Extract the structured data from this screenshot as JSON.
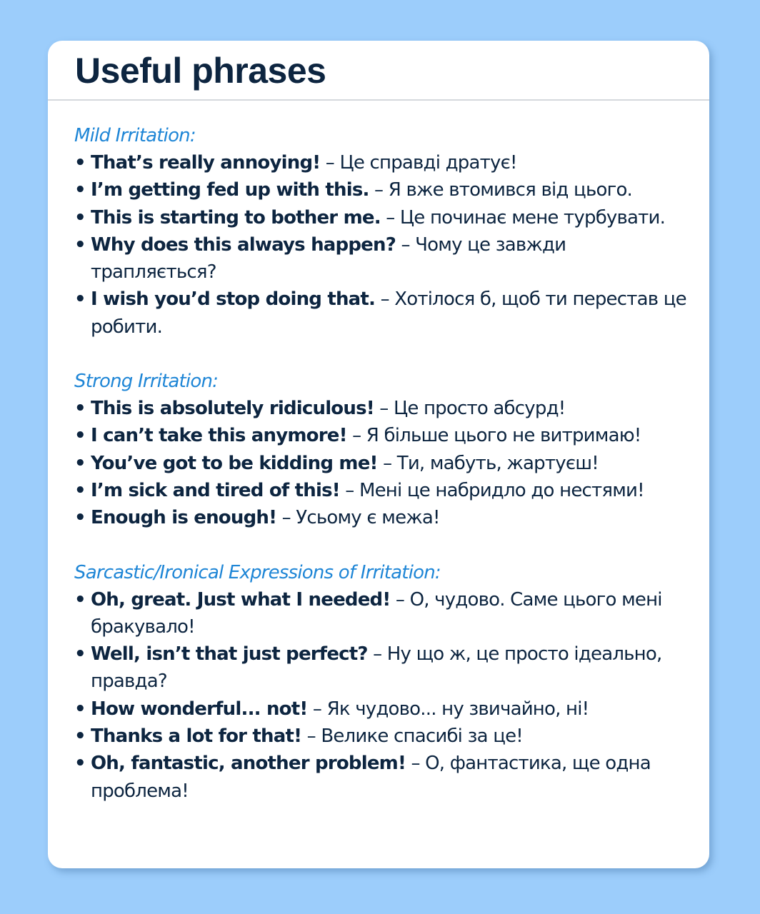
{
  "title": "Useful phrases",
  "sections": [
    {
      "heading": "Mild Irritation:",
      "items": [
        {
          "en": "That’s really annoying!",
          "ua": " – Це справді дратує!"
        },
        {
          "en": "I’m getting fed up with this.",
          "ua": " – Я вже втомився від цього."
        },
        {
          "en": "This is starting to bother me.",
          "ua": " – Це починає мене турбувати."
        },
        {
          "en": "Why does this always happen?",
          "ua": " – Чому це завжди трапляється?"
        },
        {
          "en": "I wish you’d stop doing that.",
          "ua": " – Хотілося б, щоб ти перестав це робити."
        }
      ]
    },
    {
      "heading": "Strong Irritation:",
      "items": [
        {
          "en": "This is absolutely ridiculous!",
          "ua": " – Це просто абсурд!"
        },
        {
          "en": "I can’t take this anymore!",
          "ua": " – Я більше цього не витримаю!"
        },
        {
          "en": "You’ve got to be kidding me!",
          "ua": " – Ти, мабуть, жартуєш!"
        },
        {
          "en": "I’m sick and tired of this!",
          "ua": " – Мені це набридло до нестями!"
        },
        {
          "en": "Enough is enough!",
          "ua": " – Усьому є межа!"
        }
      ]
    },
    {
      "heading": "Sarcastic/Ironical Expressions of Irritation:",
      "items": [
        {
          "en": "Oh, great. Just what I needed!",
          "ua": " – О, чудово. Саме цього мені бракувало!"
        },
        {
          "en": "Well, isn’t that just perfect?",
          "ua": " – Ну що ж, це просто ідеально, правда?"
        },
        {
          "en": "How wonderful... not!",
          "ua": " – Як чудово... ну звичайно, ні!"
        },
        {
          "en": "Thanks a lot for that!",
          "ua": " – Велике спасибі за це!"
        },
        {
          "en": "Oh, fantastic, another problem!",
          "ua": " – О, фантастика, ще одна проблема!"
        }
      ]
    }
  ]
}
